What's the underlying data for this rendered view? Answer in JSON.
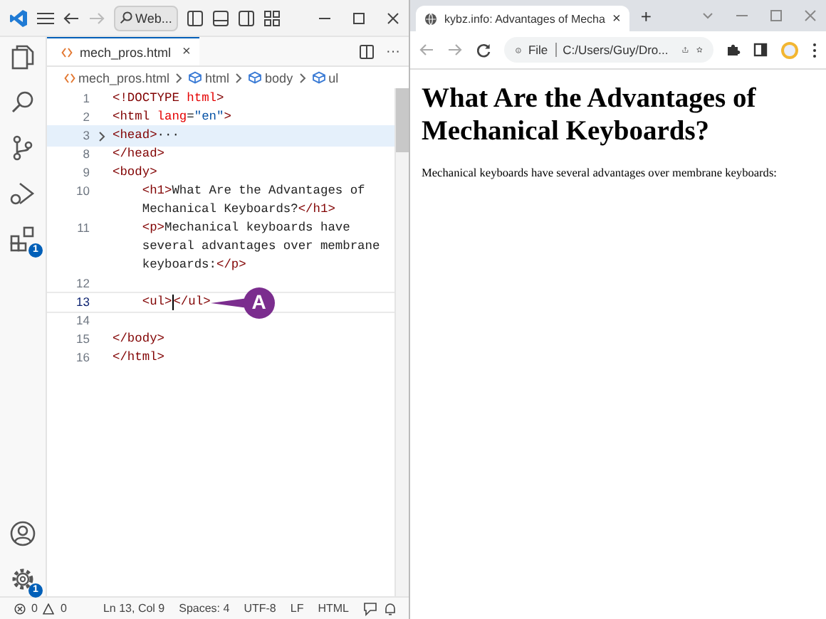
{
  "editor_window": {
    "title_bar": {
      "search": "Web..."
    },
    "activity_bar": [
      {
        "kind": "explorer"
      },
      {
        "kind": "search"
      },
      {
        "kind": "source-control"
      },
      {
        "kind": "run"
      },
      {
        "kind": "extensions",
        "badge": "1"
      }
    ],
    "activity_bottom": [
      {
        "kind": "account"
      },
      {
        "kind": "settings",
        "badge": "1"
      }
    ],
    "tab": {
      "label": "mech_pros.html",
      "close": "×",
      "more": "···"
    },
    "breadcrumb": [
      {
        "kind": "file",
        "text": "mech_pros.html"
      },
      {
        "kind": "symbol",
        "text": "html"
      },
      {
        "kind": "symbol",
        "text": "body"
      },
      {
        "kind": "symbol",
        "text": "ul"
      }
    ],
    "lines": [
      {
        "number": "1",
        "folded": false,
        "current": false,
        "rows": [
          [
            {
              "kind": "tag",
              "text": "<!DOCTYPE "
            },
            {
              "kind": "attr",
              "text": "html"
            },
            {
              "kind": "tag",
              "text": ">"
            }
          ]
        ]
      },
      {
        "number": "2",
        "folded": false,
        "current": false,
        "rows": [
          [
            {
              "kind": "tag",
              "text": "<html "
            },
            {
              "kind": "attr",
              "text": "lang"
            },
            {
              "kind": "text",
              "text": "="
            },
            {
              "kind": "string",
              "text": "\"en\""
            },
            {
              "kind": "tag",
              "text": ">"
            }
          ]
        ]
      },
      {
        "number": "3",
        "folded": true,
        "current": false,
        "rows": [
          [
            {
              "kind": "tag",
              "text": "<head>"
            },
            {
              "kind": "text",
              "text": "···"
            }
          ]
        ]
      },
      {
        "number": "8",
        "folded": false,
        "current": false,
        "rows": [
          [
            {
              "kind": "tag",
              "text": "</head>"
            }
          ]
        ]
      },
      {
        "number": "9",
        "folded": false,
        "current": false,
        "rows": [
          [
            {
              "kind": "tag",
              "text": "<body>"
            }
          ]
        ]
      },
      {
        "number": "10",
        "folded": false,
        "current": false,
        "rows": [
          [
            {
              "kind": "tag",
              "text": "    <h1>"
            },
            {
              "kind": "text",
              "text": "What Are the Advantages of"
            }
          ],
          [
            {
              "kind": "text",
              "text": "    Mechanical Keyboards?"
            },
            {
              "kind": "tag",
              "text": "</h1>"
            }
          ]
        ]
      },
      {
        "number": "11",
        "folded": false,
        "current": false,
        "rows": [
          [
            {
              "kind": "tag",
              "text": "    <p>"
            },
            {
              "kind": "text",
              "text": "Mechanical keyboards have"
            }
          ],
          [
            {
              "kind": "text",
              "text": "    several advantages over membrane"
            }
          ],
          [
            {
              "kind": "text",
              "text": "    keyboards:"
            },
            {
              "kind": "tag",
              "text": "</p>"
            }
          ]
        ]
      },
      {
        "number": "12",
        "folded": false,
        "current": false,
        "rows": [
          []
        ]
      },
      {
        "number": "13",
        "folded": false,
        "current": true,
        "rows": [
          [
            {
              "kind": "tag",
              "text": "    <ul>"
            },
            {
              "kind": "cursor",
              "text": ""
            },
            {
              "kind": "tag",
              "text": "</ul>"
            }
          ]
        ]
      },
      {
        "number": "14",
        "folded": false,
        "current": false,
        "rows": [
          []
        ]
      },
      {
        "number": "15",
        "folded": false,
        "current": false,
        "rows": [
          [
            {
              "kind": "tag",
              "text": "</body>"
            }
          ]
        ]
      },
      {
        "number": "16",
        "folded": false,
        "current": false,
        "rows": [
          [
            {
              "kind": "tag",
              "text": "</html>"
            }
          ]
        ]
      }
    ],
    "callout": "A",
    "status_bar": {
      "errors": "0",
      "warnings": "0",
      "items": [
        "Ln 13, Col 9",
        "Spaces: 4",
        "UTF-8",
        "LF",
        "HTML"
      ]
    }
  },
  "browser_window": {
    "tab": {
      "title": "kybz.info: Advantages of Mecha",
      "close": "×",
      "new": "+"
    },
    "address": {
      "scheme": "File",
      "url": "C:/Users/Guy/Dro..."
    },
    "page": {
      "heading": "What Are the Advantages of Mechanical Keyboards?",
      "paragraph": "Mechanical keyboards have several advantages over membrane keyboards:"
    }
  }
}
